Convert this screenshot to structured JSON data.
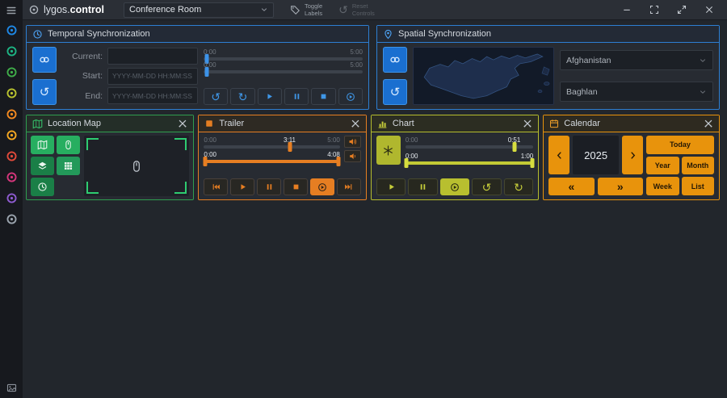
{
  "titlebar": {
    "app_name_light": "lygos.",
    "app_name_bold": "control",
    "room_selector": "Conference Room",
    "toggle_labels": [
      "Toggle",
      "Labels"
    ],
    "reset_controls": [
      "Reset",
      "Controls"
    ]
  },
  "icons": {
    "rotate_ccw": "↺",
    "rotate_cw": "↻",
    "chevrons_left": "«",
    "chevrons_right": "»"
  },
  "sidebar": {
    "items": [
      {
        "name": "device-icon-blue",
        "color": "#1e88e5"
      },
      {
        "name": "device-icon-teal",
        "color": "#1db584"
      },
      {
        "name": "device-icon-green",
        "color": "#3fae49"
      },
      {
        "name": "device-icon-lime",
        "color": "#b9c32f"
      },
      {
        "name": "device-icon-orange",
        "color": "#f58a1f"
      },
      {
        "name": "device-icon-amber",
        "color": "#f6a821"
      },
      {
        "name": "device-icon-red",
        "color": "#e24a3b"
      },
      {
        "name": "device-icon-magenta",
        "color": "#d6367c"
      },
      {
        "name": "device-icon-purple",
        "color": "#8e5bd0"
      },
      {
        "name": "device-icon-gray",
        "color": "#9aa3ad"
      }
    ]
  },
  "panels": {
    "temporal": {
      "title": "Temporal Synchronization",
      "fields": [
        {
          "label": "Current:",
          "placeholder": ""
        },
        {
          "label": "Start:",
          "placeholder": "YYYY-MM-DD HH:MM:SS"
        },
        {
          "label": "End:",
          "placeholder": "YYYY-MM-DD HH:MM:SS"
        }
      ],
      "slider_top": {
        "start": "0:00",
        "end": "5:00"
      },
      "slider_bottom": {
        "start": "0:00",
        "end": "5:00"
      }
    },
    "spatial": {
      "title": "Spatial Synchronization",
      "country": "Afghanistan",
      "region": "Baghlan"
    },
    "location_map": {
      "title": "Location Map"
    },
    "trailer": {
      "title": "Trailer",
      "seek": {
        "start": "0:00",
        "current": "3:11",
        "end": "5:00"
      },
      "range": {
        "start": "0:00",
        "end": "4:08"
      }
    },
    "chart": {
      "title": "Chart",
      "seek": {
        "start": "0:00",
        "current": "0:51"
      },
      "range": {
        "start": "0:00",
        "end": "1:00"
      }
    },
    "calendar": {
      "title": "Calendar",
      "year": "2025",
      "views": [
        "Today",
        "Year",
        "Month",
        "Week",
        "List"
      ]
    }
  }
}
